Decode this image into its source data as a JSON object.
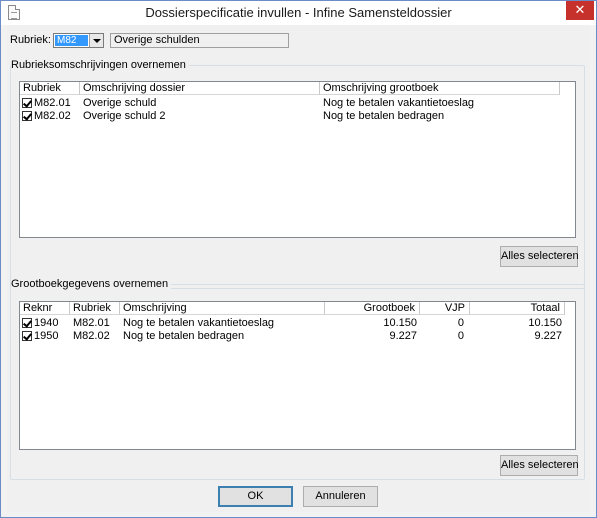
{
  "window": {
    "title": "Dossierspecificatie invullen - Infine Samensteldossier"
  },
  "rubriek": {
    "label": "Rubriek:",
    "selected": "M82",
    "description": "Overige schulden"
  },
  "group1": {
    "title": "Rubrieksomschrijvingen overnemen",
    "columns": [
      "Rubriek",
      "Omschrijving dossier",
      "Omschrijving grootboek"
    ],
    "rows": [
      {
        "checked": true,
        "rubriek": "M82.01",
        "dossier": "Overige schuld",
        "grootboek": "Nog te betalen vakantietoeslag"
      },
      {
        "checked": true,
        "rubriek": "M82.02",
        "dossier": "Overige schuld 2",
        "grootboek": "Nog te betalen bedragen"
      }
    ],
    "select_all": "Alles selecteren"
  },
  "group2": {
    "title": "Grootboekgegevens overnemen",
    "columns": [
      "Reknr",
      "Rubriek",
      "Omschrijving",
      "Grootboek",
      "VJP",
      "Totaal"
    ],
    "rows": [
      {
        "checked": true,
        "reknr": "1940",
        "rubriek": "M82.01",
        "omschrijving": "Nog te betalen vakantietoeslag",
        "grootboek": "10.150",
        "vjp": "0",
        "totaal": "10.150"
      },
      {
        "checked": true,
        "reknr": "1950",
        "rubriek": "M82.02",
        "omschrijving": "Nog te betalen bedragen",
        "grootboek": "9.227",
        "vjp": "0",
        "totaal": "9.227"
      }
    ],
    "select_all": "Alles selecteren"
  },
  "buttons": {
    "ok": "OK",
    "cancel": "Annuleren"
  },
  "icons": {
    "app": "document-icon",
    "close": "close-icon",
    "dropdown": "chevron-down-icon",
    "check": "checkmark-icon"
  },
  "colors": {
    "selection": "#3399ff",
    "close": "#c7312b",
    "window_border": "#6b8cc7"
  }
}
